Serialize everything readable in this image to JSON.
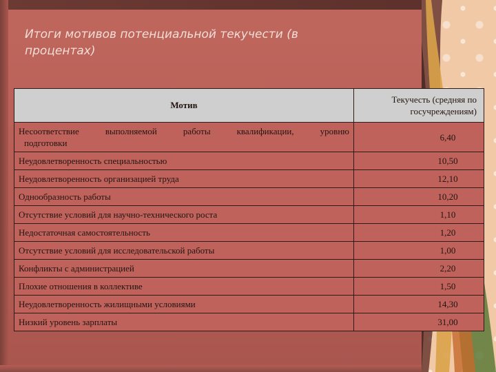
{
  "slide": {
    "title": "Итоги мотивов потенциальной текучести (в процентах)"
  },
  "table": {
    "headers": {
      "motive": "Мотив",
      "rate": "Текучесть (средняя по госучреждениям)"
    },
    "rows": [
      {
        "motive": "Несоответствие выполняемой работы квалификации, уровню",
        "motive_line2": "подготовки",
        "rate": "6,40"
      },
      {
        "motive": "Неудовлетворенность специальностью",
        "rate": "10,50"
      },
      {
        "motive": "Неудовлетворенность организацией труда",
        "rate": "12,10"
      },
      {
        "motive": "Однообразность работы",
        "rate": "10,20"
      },
      {
        "motive": "Отсутствие условий для научно-технического роста",
        "rate": "1,10"
      },
      {
        "motive": "Недостаточная самостоятельность",
        "rate": "1,20"
      },
      {
        "motive": "Отсутствие условий для исследовательской работы",
        "rate": "1,00"
      },
      {
        "motive": "Конфликты с администрацией",
        "rate": "2,20"
      },
      {
        "motive": "Плохие отношения в коллективе",
        "rate": "1,50"
      },
      {
        "motive": "Неудовлетворенность жилищными условиями",
        "rate": "14,30"
      },
      {
        "motive": "Низкий уровень зарплаты",
        "rate": "31,00"
      }
    ]
  },
  "colors": {
    "background": "#b5625a",
    "table_header": "#cfcfcf",
    "table_cell": "#bf625b",
    "deco_panel": "#f1c9a6"
  }
}
